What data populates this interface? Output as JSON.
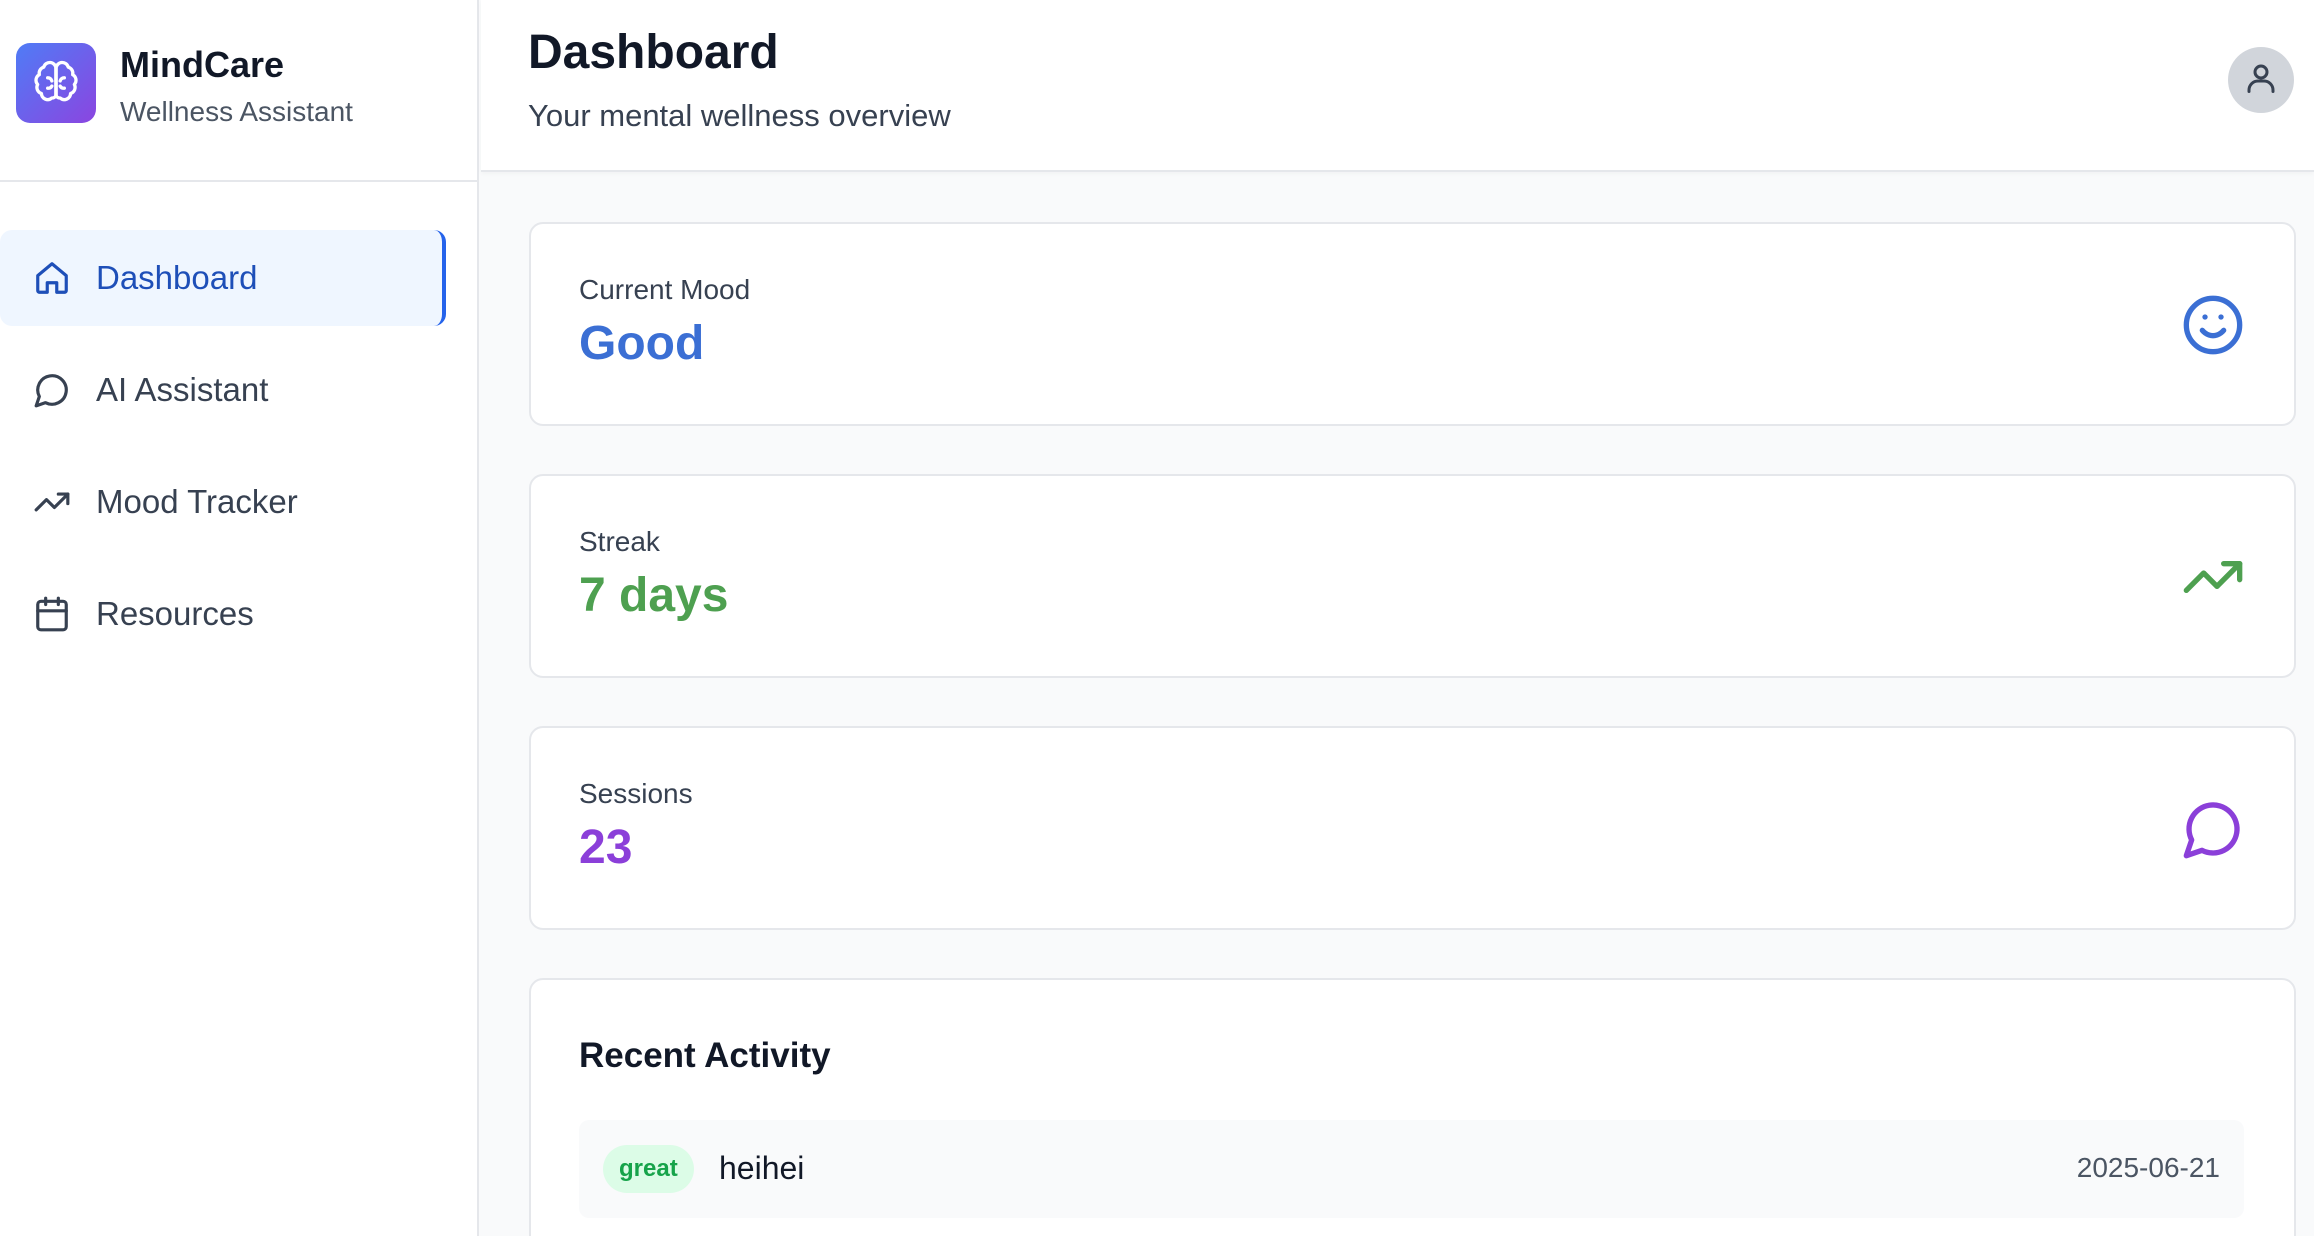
{
  "brand": {
    "title": "MindCare",
    "subtitle": "Wellness Assistant",
    "logo_icon": "brain-icon",
    "logo_gradient": [
      "#4f7cf6",
      "#8b45e0"
    ]
  },
  "nav": {
    "items": [
      {
        "label": "Dashboard",
        "icon": "home-icon",
        "active": true
      },
      {
        "label": "AI Assistant",
        "icon": "chat-bubble-icon",
        "active": false
      },
      {
        "label": "Mood Tracker",
        "icon": "trending-up-icon",
        "active": false
      },
      {
        "label": "Resources",
        "icon": "calendar-icon",
        "active": false
      }
    ]
  },
  "header": {
    "title": "Dashboard",
    "subtitle": "Your mental wellness overview",
    "avatar_icon": "user-icon"
  },
  "stats": [
    {
      "label": "Current Mood",
      "value": "Good",
      "color": "#3b6fd4",
      "icon": "smile-icon"
    },
    {
      "label": "Streak",
      "value": "7 days",
      "color": "#4ea050",
      "icon": "trending-up-icon"
    },
    {
      "label": "Sessions",
      "value": "23",
      "color": "#8b3fd9",
      "icon": "chat-bubble-icon"
    }
  ],
  "activity": {
    "title": "Recent Activity",
    "items": [
      {
        "mood": "great",
        "note": "heihei",
        "date": "2025-06-21"
      }
    ]
  },
  "colors": {
    "accent": "#2563eb",
    "active_bg": "#eff6ff",
    "badge_bg": "#dcfce7",
    "badge_text": "#16a34a"
  }
}
